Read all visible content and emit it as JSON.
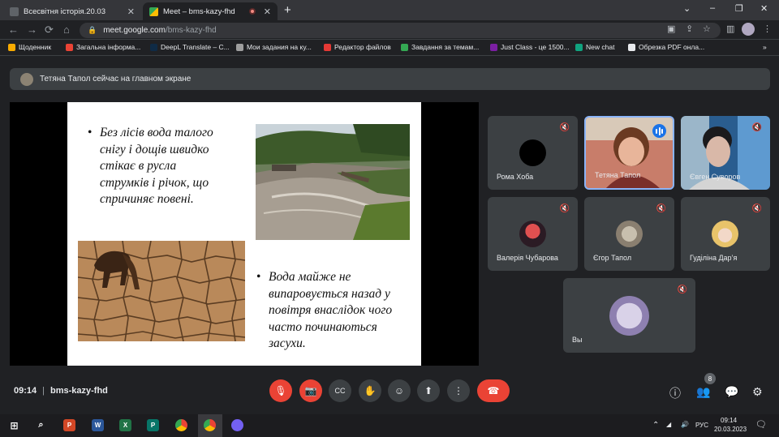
{
  "browser": {
    "tabs": [
      {
        "title": "Всесвітня історія.20.03",
        "close": "✕"
      },
      {
        "title": "Meet – bms-kazy-fhd",
        "close": "✕"
      }
    ],
    "new_tab": "+",
    "window_controls": [
      "⌄",
      "–",
      "❐",
      "✕"
    ],
    "url_host": "meet.google.com",
    "url_path": "/bms-kazy-fhd",
    "bookmarks": [
      {
        "label": "Щоденник",
        "color": "#f9ab00"
      },
      {
        "label": "Загальна інформа...",
        "color": "#ea4335"
      },
      {
        "label": "DeepL Translate – С...",
        "color": "#0f2b46"
      },
      {
        "label": "Мои задания на ку...",
        "color": "#9e9e9e"
      },
      {
        "label": "Редактор файлов",
        "color": "#e53935"
      },
      {
        "label": "Завдання за темам...",
        "color": "#34a853"
      },
      {
        "label": "Just Class - це 1500...",
        "color": "#7b1fa2"
      },
      {
        "label": "New chat",
        "color": "#10a37f"
      },
      {
        "label": "Обрезка PDF онла...",
        "color": "#e8eaed"
      }
    ],
    "bookmarks_more": "»"
  },
  "meet": {
    "banner": "Тетяна Тапол сейчас на главном экране",
    "slide": {
      "bullet1": [
        "Без лісів вода талого",
        "снігу і дощів швидко",
        "стікає в русла",
        "струмків і річок, що",
        "спричиняє повені."
      ],
      "bullet2": [
        "Вода майже не",
        "випаровується назад у",
        "повітря внаслідок чого",
        "часто починаються",
        "засухи."
      ],
      "bullet_char": "•"
    },
    "participants": [
      {
        "name": "Рома Хоба"
      },
      {
        "name": "Тетяна Тапол"
      },
      {
        "name": "Євген Суворов"
      },
      {
        "name": "Валерія Чубарова"
      },
      {
        "name": "Єгор Тапол"
      },
      {
        "name": "Гуділіна Дар’я"
      },
      {
        "name": "Вы"
      }
    ],
    "mic_off_icon": "🎙",
    "time": "09:14",
    "meeting_code": "bms-kazy-fhd",
    "people_count": "8",
    "controls": {
      "mic": "🎙",
      "cam": "📷",
      "cc": "CC",
      "hand": "✋",
      "emoji": "☺",
      "present": "⬆",
      "more": "⋮",
      "end": "☎"
    },
    "right": {
      "info": "ⓘ",
      "people": "👥",
      "chat": "💬",
      "activities": "⚙"
    }
  },
  "taskbar": {
    "lang": "РУС",
    "time": "09:14",
    "date": "20.03.2023",
    "apps": [
      "P",
      "W",
      "X",
      "P",
      "⬤",
      "⬤",
      "⬤"
    ]
  }
}
